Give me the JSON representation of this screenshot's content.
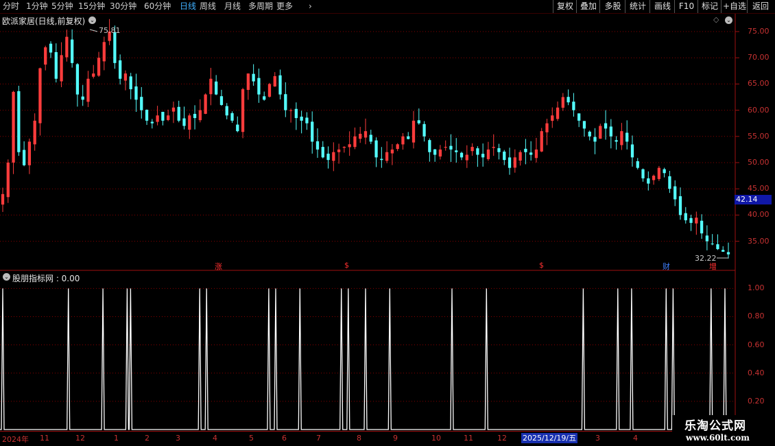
{
  "toolbar": {
    "timeframes": [
      "分时",
      "1分钟",
      "5分钟",
      "15分钟",
      "30分钟",
      "60分钟",
      "日线",
      "周线",
      "月线",
      "多周期",
      "更多"
    ],
    "more_arrow": "›",
    "active": "日线",
    "right_buttons": [
      "复权",
      "叠加",
      "多股",
      "统计",
      "画线",
      "F10",
      "标记",
      "+自选",
      "返回"
    ]
  },
  "stock": {
    "title": "欧派家居(日线,前复权)",
    "high_label": "75.81",
    "low_label": "32.22",
    "current_price": "42.14"
  },
  "indicator": {
    "title": "股朋指标网 : 0.00"
  },
  "price_axis": [
    "75.00",
    "70.00",
    "65.00",
    "60.00",
    "55.00",
    "50.00",
    "45.00",
    "40.00",
    "35.00"
  ],
  "ind_axis": [
    "1.00",
    "0.80",
    "0.60",
    "0.40",
    "0.20"
  ],
  "date_axis": {
    "labels": [
      "2024年",
      "11",
      "12",
      "1",
      "2",
      "3",
      "4",
      "5",
      "6",
      "7",
      "8",
      "9",
      "10",
      "11",
      "12",
      "3",
      "4"
    ],
    "highlight": "2025/12/19/五"
  },
  "events": [
    {
      "text": "涨",
      "color": "#ff3030"
    },
    {
      "text": "$",
      "color": "#ff3030"
    },
    {
      "text": "$",
      "color": "#ff3030"
    },
    {
      "text": "财",
      "color": "#4080ff"
    },
    {
      "text": "增",
      "color": "#ff3030"
    }
  ],
  "watermark": {
    "line1": "乐淘公式网",
    "line2": "www.60lt.com"
  },
  "colors": {
    "up": "#ff3c3c",
    "down": "#54ffff",
    "grid": "#8b0000",
    "axis_text": "#c83232"
  },
  "chart_data": {
    "type": "candlestick",
    "price_range": [
      32.22,
      75.81
    ],
    "closes": [
      44.0,
      50.0,
      63.5,
      52.0,
      49.5,
      54.0,
      58.0,
      68.0,
      72.0,
      71.0,
      66.0,
      70.5,
      74.0,
      69.0,
      63.0,
      62.0,
      66.0,
      67.0,
      70.0,
      73.0,
      75.0,
      69.0,
      66.0,
      67.0,
      64.0,
      62.0,
      60.0,
      58.0,
      57.5,
      59.0,
      58.0,
      59.0,
      60.5,
      58.0,
      57.0,
      59.0,
      58.5,
      60.0,
      63.0,
      66.0,
      63.0,
      61.0,
      59.0,
      58.0,
      56.0,
      64.0,
      67.0,
      65.5,
      63.0,
      62.0,
      65.0,
      66.5,
      63.0,
      60.0,
      60.0,
      58.5,
      58.0,
      57.5,
      54.0,
      52.5,
      51.0,
      50.5,
      52.0,
      52.5,
      53.0,
      53.5,
      55.0,
      55.5,
      56.0,
      54.0,
      51.0,
      50.5,
      52.0,
      52.5,
      53.5,
      55.0,
      54.5,
      58.0,
      57.5,
      55.0,
      52.0,
      51.5,
      52.5,
      53.0,
      52.5,
      52.0,
      51.0,
      51.5,
      53.0,
      51.5,
      51.0,
      52.5,
      53.0,
      52.0,
      50.5,
      49.0,
      51.0,
      52.0,
      52.0,
      51.5,
      52.5,
      56.0,
      57.5,
      59.0,
      60.5,
      62.5,
      61.5,
      60.0,
      58.0,
      56.5,
      55.0,
      54.0,
      57.0,
      56.5,
      55.0,
      54.0,
      56.0,
      54.0,
      51.0,
      49.0,
      47.0,
      46.0,
      47.5,
      49.0,
      48.0,
      45.0,
      43.0,
      40.0,
      39.0,
      38.5,
      39.5,
      36.5,
      35.0,
      34.5,
      33.5,
      33.0,
      32.5
    ],
    "indicator_signal_bars": [
      0,
      19,
      29,
      36,
      37,
      57,
      59,
      77,
      79,
      86,
      98,
      100,
      105,
      112,
      130,
      140,
      168,
      178,
      182,
      192,
      194,
      205,
      209
    ],
    "indicator_range": [
      0.0,
      1.0
    ]
  }
}
